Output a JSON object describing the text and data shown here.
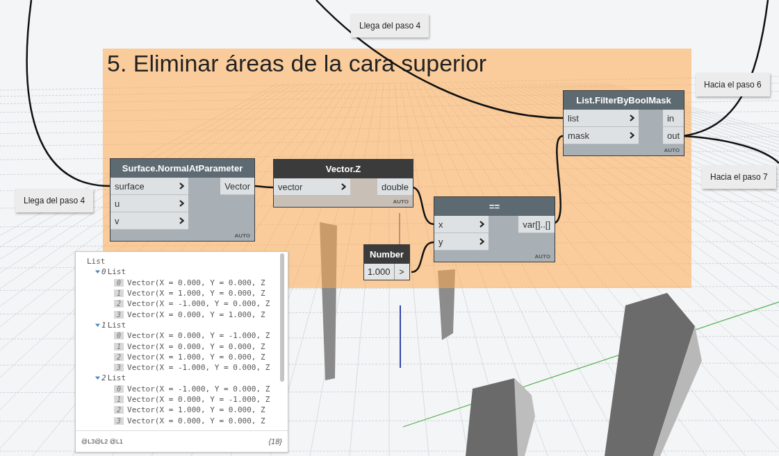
{
  "group": {
    "title": "5. Eliminar áreas de la cara superior"
  },
  "nodes": [
    {
      "kind": "function",
      "title": "Surface.NormalAtParameter",
      "selected": false,
      "inputs": [
        "surface",
        "u",
        "v"
      ],
      "outputs": [
        "Vector"
      ],
      "lacing": "AUTO"
    },
    {
      "kind": "function",
      "title": "Vector.Z",
      "selected": true,
      "inputs": [
        "vector"
      ],
      "outputs": [
        "double"
      ],
      "lacing": "AUTO"
    },
    {
      "kind": "function",
      "title": "==",
      "selected": false,
      "inputs": [
        "x",
        "y"
      ],
      "outputs": [
        "var[]..[]"
      ],
      "lacing": "AUTO"
    },
    {
      "kind": "number",
      "title": "Number",
      "selected": false,
      "value": "1.000",
      "arrow": ">"
    },
    {
      "kind": "function",
      "title": "List.FilterByBoolMask",
      "selected": false,
      "inputs": [
        "list",
        "mask"
      ],
      "outputs": [
        "in",
        "out"
      ],
      "lacing": "AUTO"
    }
  ],
  "notes": [
    "Llega del paso 4",
    "Llega del paso 4",
    "Hacia el paso 6",
    "Hacia el paso 7"
  ],
  "preview": {
    "label": "List",
    "children": [
      {
        "index": "0",
        "label": "List",
        "expanded": true,
        "children": [
          {
            "index": "0",
            "value": "Vector(X = 0.000, Y = 0.000, Z"
          },
          {
            "index": "1",
            "value": "Vector(X = 1.000, Y = 0.000, Z"
          },
          {
            "index": "2",
            "value": "Vector(X = -1.000, Y = 0.000, Z"
          },
          {
            "index": "3",
            "value": "Vector(X = 0.000, Y = 1.000, Z"
          }
        ]
      },
      {
        "index": "1",
        "label": "List",
        "expanded": true,
        "children": [
          {
            "index": "0",
            "value": "Vector(X = 0.000, Y = -1.000, Z"
          },
          {
            "index": "1",
            "value": "Vector(X = 0.000, Y = 0.000, Z"
          },
          {
            "index": "2",
            "value": "Vector(X = 1.000, Y = 0.000, Z"
          },
          {
            "index": "3",
            "value": "Vector(X = -1.000, Y = 0.000, Z"
          }
        ]
      },
      {
        "index": "2",
        "label": "List",
        "expanded": true,
        "children": [
          {
            "index": "0",
            "value": "Vector(X = -1.000, Y = 0.000, Z"
          },
          {
            "index": "1",
            "value": "Vector(X = 0.000, Y = -1.000, Z"
          },
          {
            "index": "2",
            "value": "Vector(X = 1.000, Y = 0.000, Z"
          },
          {
            "index": "3",
            "value": "Vector(X = 0.000, Y = 0.000, Z"
          }
        ]
      }
    ],
    "levels": "@L3@L2 @L1",
    "count": "{18}"
  }
}
